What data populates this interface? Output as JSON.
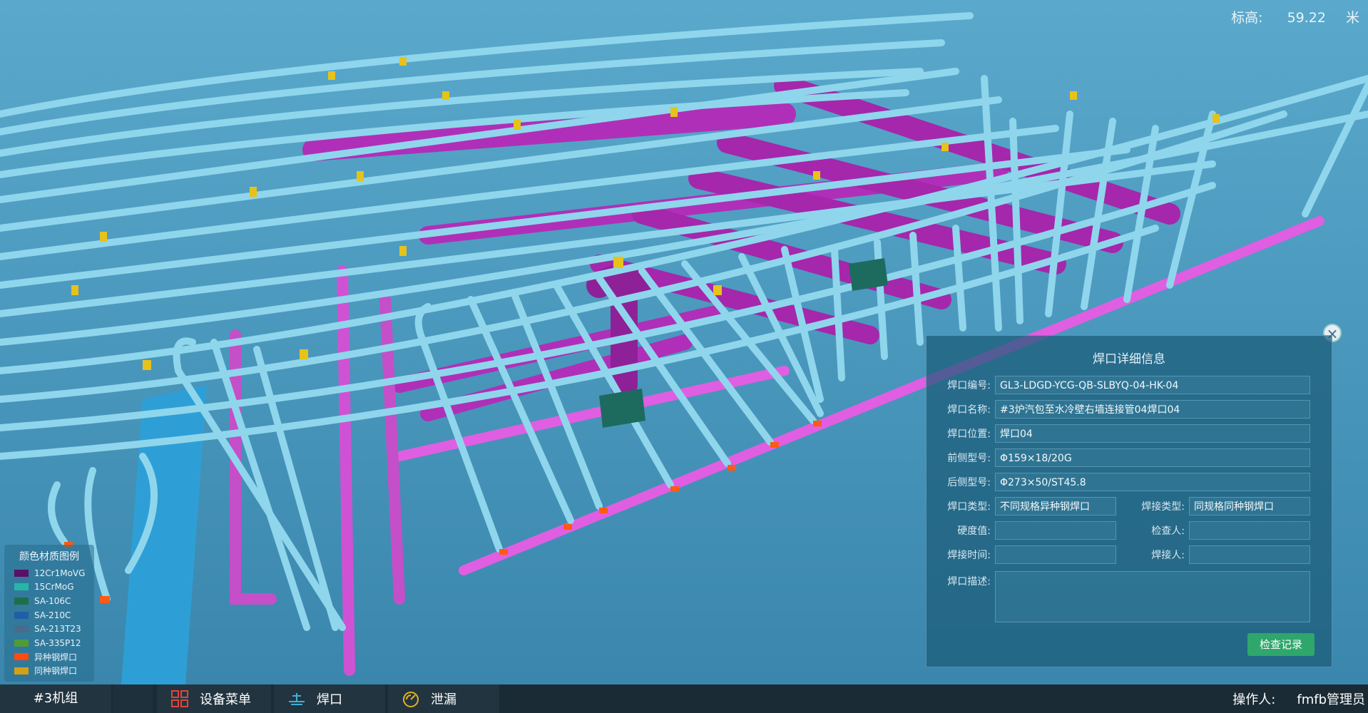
{
  "elevation": {
    "label": "标高:",
    "value": "59.22",
    "unit": "米"
  },
  "legend": {
    "title": "颜色材质图例",
    "items": [
      {
        "label": "12Cr1MoVG",
        "color": "#5b0f66"
      },
      {
        "label": "15CrMoG",
        "color": "#27b5a8"
      },
      {
        "label": "SA-106C",
        "color": "#1e6e4a"
      },
      {
        "label": "SA-210C",
        "color": "#1f5fa8"
      },
      {
        "label": "SA-213T23",
        "color": "#4a6b8a"
      },
      {
        "label": "SA-335P12",
        "color": "#4f9b3a"
      },
      {
        "label": "异种钢焊口",
        "color": "#ff4a10"
      },
      {
        "label": "同种钢焊口",
        "color": "#d4a017"
      }
    ]
  },
  "panel": {
    "title": "焊口详细信息",
    "close_icon": "close-icon",
    "fields": {
      "code": {
        "label": "焊口编号:",
        "value": "GL3-LDGD-YCG-QB-SLBYQ-04-HK-04"
      },
      "name": {
        "label": "焊口名称:",
        "value": "#3炉汽包至水冷壁右墙连接管04焊口04"
      },
      "position": {
        "label": "焊口位置:",
        "value": "焊口04"
      },
      "front_model": {
        "label": "前侧型号:",
        "value": "Φ159×18/20G"
      },
      "rear_model": {
        "label": "后侧型号:",
        "value": "Φ273×50/ST45.8"
      },
      "joint_type": {
        "label": "焊口类型:",
        "value": "不同规格异种钢焊口"
      },
      "weld_type": {
        "label": "焊接类型:",
        "value": "同规格同种钢焊口"
      },
      "hardness": {
        "label": "硬度值:",
        "value": ""
      },
      "inspector": {
        "label": "检查人:",
        "value": ""
      },
      "weld_time": {
        "label": "焊接时间:",
        "value": ""
      },
      "welder": {
        "label": "焊接人:",
        "value": ""
      },
      "description": {
        "label": "焊口描述:",
        "value": ""
      }
    },
    "check_button": "检查记录"
  },
  "taskbar": {
    "unit": "#3机组",
    "buttons": [
      {
        "label": "设备菜单",
        "icon": "grid-menu-icon"
      },
      {
        "label": "焊口",
        "icon": "weld-joint-icon"
      },
      {
        "label": "泄漏",
        "icon": "leak-gauge-icon"
      }
    ],
    "operator_label": "操作人:",
    "operator": "fmfb管理员"
  },
  "colors": {
    "background": "#3f8fb4",
    "pipe_light": "#8fd6ec",
    "pipe_magenta": "#b02fb8",
    "weld_yellow": "#e6c21a",
    "weld_orange": "#ff5a12",
    "button_green": "#2fa66b"
  }
}
